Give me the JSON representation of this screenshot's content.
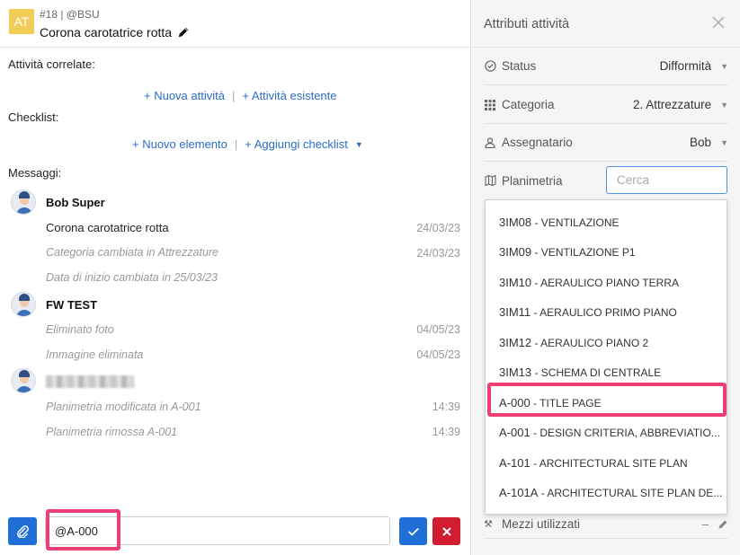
{
  "header": {
    "avatar_text": "AT",
    "task_id": "#18 | @BSU",
    "task_title": "Corona carotatrice rotta"
  },
  "related": {
    "label": "Attività correlate:",
    "new_activity": "+ Nuova attività",
    "existing_activity": "+ Attività esistente",
    "separator": "|"
  },
  "checklist": {
    "label": "Checklist:",
    "new_element": "+ Nuovo elemento",
    "add_checklist": "+ Aggiungi checklist",
    "separator": "|"
  },
  "messages": {
    "label": "Messaggi:",
    "groups": [
      {
        "author": "Bob Super",
        "lines": [
          {
            "text": "Corona carotatrice rotta",
            "date": "24/03/23"
          },
          {
            "text": "Categoria cambiata in Attrezzature",
            "date": "24/03/23"
          },
          {
            "text": "Data di inizio cambiata in 25/03/23",
            "date": ""
          }
        ]
      },
      {
        "author": "FW TEST",
        "lines": [
          {
            "text": "Eliminato foto",
            "date": "04/05/23"
          },
          {
            "text": "Immagine eliminata",
            "date": "04/05/23"
          }
        ]
      },
      {
        "author": "",
        "lines": [
          {
            "text": "Planimetria modificata in A-001",
            "date": "14:39"
          },
          {
            "text": "Planimetria rimossa A-001",
            "date": "14:39"
          }
        ]
      }
    ]
  },
  "composer": {
    "value": "@A-000"
  },
  "panel": {
    "title": "Attributi attività",
    "attributes": [
      {
        "label": "Status",
        "value": "Difformità"
      },
      {
        "label": "Categoria",
        "value": "2. Attrezzature"
      },
      {
        "label": "Assegnatario",
        "value": "Bob"
      },
      {
        "label": "Planimetria",
        "value": ""
      }
    ],
    "search_placeholder": "Cerca",
    "mezzi_label": "Mezzi utilizzati",
    "mezzi_value": "–"
  },
  "dropdown": {
    "items": [
      {
        "code": "3IM08",
        "name": " - VENTILAZIONE"
      },
      {
        "code": "3IM09",
        "name": " - VENTILAZIONE P1"
      },
      {
        "code": "3IM10",
        "name": " - AERAULICO PIANO TERRA"
      },
      {
        "code": "3IM11",
        "name": " - AERAULICO PRIMO PIANO"
      },
      {
        "code": "3IM12",
        "name": " - AERAULICO PIANO 2"
      },
      {
        "code": "3IM13",
        "name": " - SCHEMA DI CENTRALE"
      },
      {
        "code": "A-000",
        "name": " - TITLE PAGE"
      },
      {
        "code": "A-001",
        "name": " - DESIGN CRITERIA, ABBREVIATIO..."
      },
      {
        "code": "A-101",
        "name": " - ARCHITECTURAL SITE PLAN"
      },
      {
        "code": "A-101A",
        "name": " - ARCHITECTURAL SITE PLAN DE..."
      }
    ],
    "highlighted_index": 6
  },
  "colors": {
    "link": "#2b6cc4",
    "primary": "#1f6fd6",
    "danger": "#d21d30",
    "highlight": "#ee3f74",
    "avatar": "#f3cd58"
  }
}
